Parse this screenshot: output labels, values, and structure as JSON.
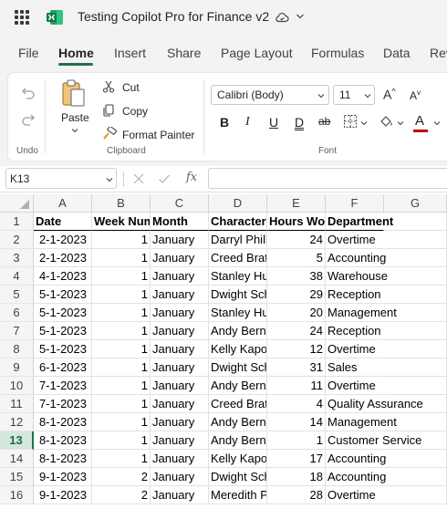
{
  "app": {
    "title": "Testing Copilot Pro for Finance v2",
    "icons": {
      "launcher": "waffle-icon",
      "app_logo": "excel-logo",
      "autosave": "cloud-sync-icon",
      "menu": "chevron-down-icon"
    },
    "accent_color": "#217346"
  },
  "menu": {
    "tabs": [
      "File",
      "Home",
      "Insert",
      "Share",
      "Page Layout",
      "Formulas",
      "Data",
      "Rev"
    ],
    "active": "Home"
  },
  "ribbon": {
    "undo_group": {
      "label": "Undo"
    },
    "clipboard": {
      "label": "Clipboard",
      "paste": "Paste",
      "cut": "Cut",
      "copy": "Copy",
      "format_painter": "Format Painter"
    },
    "font": {
      "label": "Font",
      "family": "Calibri (Body)",
      "size": "11",
      "increase": "A",
      "decrease": "A",
      "bold": "B",
      "italic": "I",
      "underline": "U",
      "double_underline": "D",
      "strikethrough": "ab",
      "font_color": "A",
      "font_color_swatch": "#c00000"
    }
  },
  "formula_bar": {
    "name_box": "K13",
    "fx": "fx",
    "value": ""
  },
  "sheet": {
    "columns": [
      "A",
      "B",
      "C",
      "D",
      "E",
      "F",
      "G"
    ],
    "rows": [
      "1",
      "2",
      "3",
      "4",
      "5",
      "6",
      "7",
      "8",
      "9",
      "10",
      "11",
      "12",
      "13",
      "14",
      "15",
      "16"
    ],
    "selected_row": "13",
    "header": [
      "Date",
      "Week Num",
      "Month",
      "Character",
      "Hours Worked",
      "Department"
    ],
    "data": [
      [
        "2-1-2023",
        "1",
        "January",
        "Darryl Philbin",
        "24",
        "Overtime"
      ],
      [
        "2-1-2023",
        "1",
        "January",
        "Creed Bratton",
        "5",
        "Accounting"
      ],
      [
        "4-1-2023",
        "1",
        "January",
        "Stanley Hudson",
        "38",
        "Warehouse"
      ],
      [
        "5-1-2023",
        "1",
        "January",
        "Dwight Schrute",
        "29",
        "Reception"
      ],
      [
        "5-1-2023",
        "1",
        "January",
        "Stanley Hudson",
        "20",
        "Management"
      ],
      [
        "5-1-2023",
        "1",
        "January",
        "Andy Bernard",
        "24",
        "Reception"
      ],
      [
        "5-1-2023",
        "1",
        "January",
        "Kelly Kapoor",
        "12",
        "Overtime"
      ],
      [
        "6-1-2023",
        "1",
        "January",
        "Dwight Schrute",
        "31",
        "Sales"
      ],
      [
        "7-1-2023",
        "1",
        "January",
        "Andy Bernard",
        "11",
        "Overtime"
      ],
      [
        "7-1-2023",
        "1",
        "January",
        "Creed Bratton",
        "4",
        "Quality Assurance"
      ],
      [
        "8-1-2023",
        "1",
        "January",
        "Andy Bernard",
        "14",
        "Management"
      ],
      [
        "8-1-2023",
        "1",
        "January",
        "Andy Bernard",
        "1",
        "Customer Service"
      ],
      [
        "8-1-2023",
        "1",
        "January",
        "Kelly Kapoor",
        "17",
        "Accounting"
      ],
      [
        "9-1-2023",
        "2",
        "January",
        "Dwight Schrute",
        "18",
        "Accounting"
      ],
      [
        "9-1-2023",
        "2",
        "January",
        "Meredith Palmer",
        "28",
        "Overtime"
      ]
    ]
  }
}
